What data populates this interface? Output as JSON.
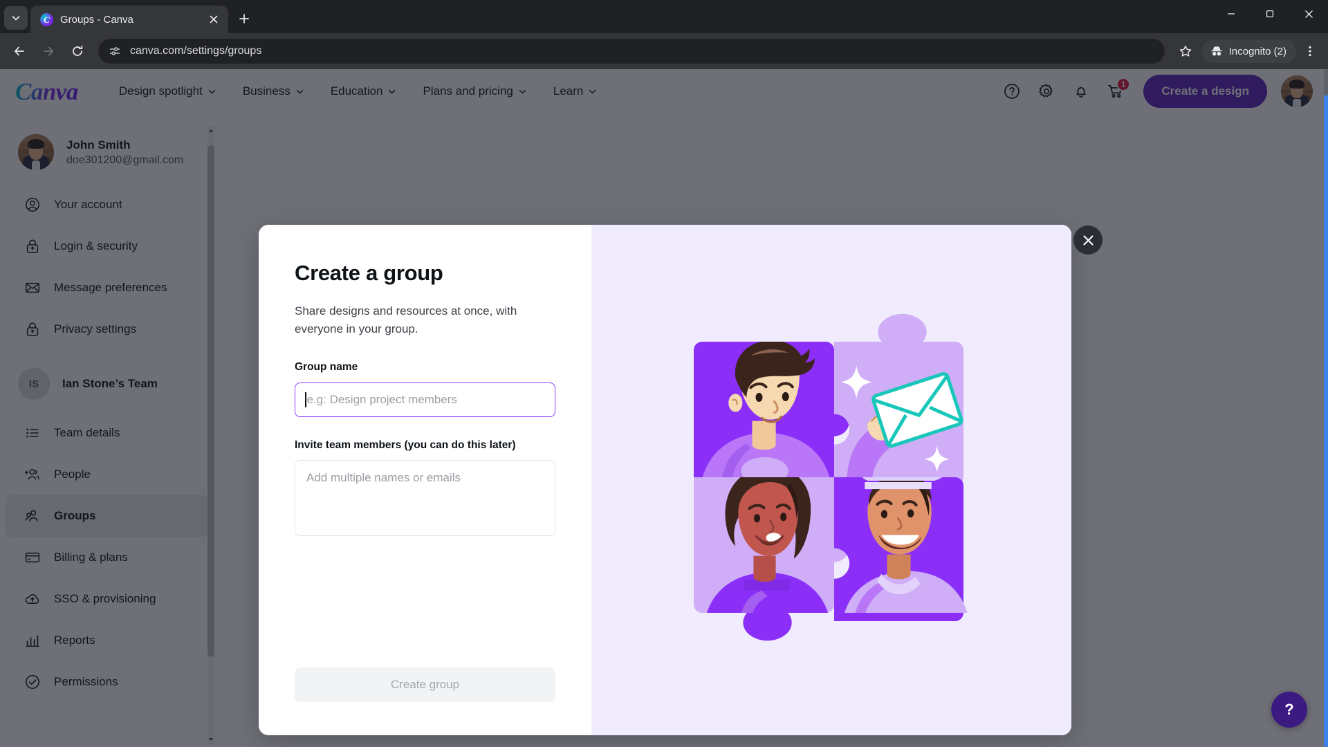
{
  "browser": {
    "tab": {
      "title": "Groups - Canva",
      "favicon_letter": "C"
    },
    "tab_search_icon": "chevron-down-icon",
    "new_tab_icon": "plus-icon",
    "close_tab_icon": "close-icon",
    "window": {
      "minimize": "–",
      "maximize": "□",
      "close": "×"
    },
    "nav": {
      "back": "←",
      "forward": "→",
      "reload": "⟳"
    },
    "omnibox": {
      "url": "canva.com/settings/groups",
      "icon": "site-settings-icon"
    },
    "star_icon": "bookmark-star-icon",
    "profile": {
      "label": "Incognito (2)",
      "icon": "incognito-icon"
    },
    "menu_icon": "three-dot-menu-icon"
  },
  "header": {
    "logo": "Canva",
    "nav_items": [
      {
        "label": "Design spotlight",
        "has_caret": true
      },
      {
        "label": "Business",
        "has_caret": true
      },
      {
        "label": "Education",
        "has_caret": true
      },
      {
        "label": "Plans and pricing",
        "has_caret": true
      },
      {
        "label": "Learn",
        "has_caret": true
      }
    ],
    "icons": [
      {
        "name": "help-icon",
        "glyph": "?"
      },
      {
        "name": "settings-gear-icon",
        "glyph": "gear"
      },
      {
        "name": "notifications-bell-icon",
        "glyph": "bell"
      },
      {
        "name": "cart-icon",
        "glyph": "cart",
        "badge": "1"
      }
    ],
    "create_button": "Create a design",
    "avatar_name": "account-avatar"
  },
  "sidebar": {
    "user": {
      "name": "John Smith",
      "email": "doe301200@gmail.com"
    },
    "account_items": [
      {
        "label": "Your account",
        "icon": "user-circle-icon"
      },
      {
        "label": "Login & security",
        "icon": "lock-icon"
      },
      {
        "label": "Message preferences",
        "icon": "envelope-icon"
      },
      {
        "label": "Privacy settings",
        "icon": "lock-icon"
      }
    ],
    "team": {
      "initials": "IS",
      "name": "Ian Stone’s Team"
    },
    "team_items": [
      {
        "label": "Team details",
        "icon": "list-icon",
        "active": false
      },
      {
        "label": "People",
        "icon": "add-people-icon",
        "active": false
      },
      {
        "label": "Groups",
        "icon": "groups-icon",
        "active": true
      },
      {
        "label": "Billing & plans",
        "icon": "credit-card-icon",
        "active": false
      },
      {
        "label": "SSO & provisioning",
        "icon": "cloud-upload-icon",
        "active": false
      },
      {
        "label": "Reports",
        "icon": "bar-chart-icon",
        "active": false
      },
      {
        "label": "Permissions",
        "icon": "check-circle-icon",
        "active": false
      }
    ]
  },
  "modal": {
    "title": "Create a group",
    "subtitle": "Share designs and resources at once, with everyone in your group.",
    "group_name_label": "Group name",
    "group_name_value": "",
    "group_name_placeholder": "e.g: Design project members",
    "invite_label": "Invite team members (you can do this later)",
    "invite_value": "",
    "invite_placeholder": "Add multiple names or emails",
    "submit_label": "Create group",
    "close_icon": "close-icon",
    "illustration": {
      "name": "puzzle-people-illustration",
      "colors": {
        "background": "#f0ecfd",
        "tile_dark": "#8b2ff8",
        "tile_light": "#cfaef7",
        "envelope_accent": "#19c7ba",
        "skin_light": "#f6d9b0",
        "skin_medium": "#e0936b",
        "skin_dark": "#c1564f",
        "hair_dark": "#3b241c"
      }
    }
  },
  "help_fab": {
    "label": "?",
    "icon": "help-question-icon"
  },
  "colors": {
    "brand_purple": "#8b3dff",
    "create_button": "#5b21c0",
    "badge_red": "#d8123c",
    "scrim": "rgba(22,24,35,0.62)"
  }
}
